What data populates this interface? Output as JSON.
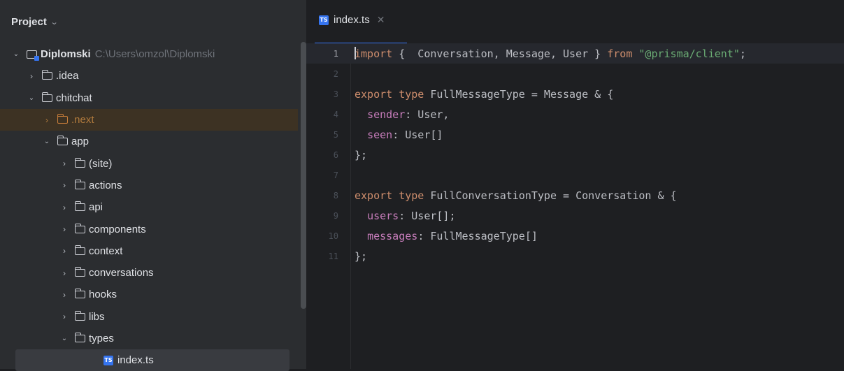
{
  "project_panel": {
    "title": "Project",
    "tree": [
      {
        "label": "Diplomski",
        "path": "C:\\Users\\omzol\\Diplomski"
      },
      {
        "label": ".idea"
      },
      {
        "label": "chitchat"
      },
      {
        "label": ".next"
      },
      {
        "label": "app"
      },
      {
        "label": "(site)"
      },
      {
        "label": "actions"
      },
      {
        "label": "api"
      },
      {
        "label": "components"
      },
      {
        "label": "context"
      },
      {
        "label": "conversations"
      },
      {
        "label": "hooks"
      },
      {
        "label": "libs"
      },
      {
        "label": "types"
      },
      {
        "label": "index.ts"
      }
    ]
  },
  "editor": {
    "tab": {
      "label": "index.ts",
      "icon_text": "TS"
    },
    "current_line": 1,
    "lines": [
      {
        "n": "1",
        "t": [
          {
            "k": "kw",
            "v": "import"
          },
          {
            "k": "p",
            "v": " {  Conversation, Message, User } "
          },
          {
            "k": "kw",
            "v": "from"
          },
          {
            "k": "p",
            "v": " "
          },
          {
            "k": "str",
            "v": "\"@prisma/client\""
          },
          {
            "k": "p",
            "v": ";"
          }
        ]
      },
      {
        "n": "2",
        "t": []
      },
      {
        "n": "3",
        "t": [
          {
            "k": "kw",
            "v": "export type"
          },
          {
            "k": "p",
            "v": " FullMessageType = Message & {"
          }
        ]
      },
      {
        "n": "4",
        "t": [
          {
            "k": "p",
            "v": "  "
          },
          {
            "k": "fld",
            "v": "sender"
          },
          {
            "k": "p",
            "v": ": User,"
          }
        ]
      },
      {
        "n": "5",
        "t": [
          {
            "k": "p",
            "v": "  "
          },
          {
            "k": "fld",
            "v": "seen"
          },
          {
            "k": "p",
            "v": ": User[]"
          }
        ]
      },
      {
        "n": "6",
        "t": [
          {
            "k": "p",
            "v": "};"
          }
        ]
      },
      {
        "n": "7",
        "t": []
      },
      {
        "n": "8",
        "t": [
          {
            "k": "kw",
            "v": "export type"
          },
          {
            "k": "p",
            "v": " FullConversationType = Conversation & {"
          }
        ]
      },
      {
        "n": "9",
        "t": [
          {
            "k": "p",
            "v": "  "
          },
          {
            "k": "fld",
            "v": "users"
          },
          {
            "k": "p",
            "v": ": User[];"
          }
        ]
      },
      {
        "n": "10",
        "t": [
          {
            "k": "p",
            "v": "  "
          },
          {
            "k": "fld",
            "v": "messages"
          },
          {
            "k": "p",
            "v": ": FullMessageType[]"
          }
        ]
      },
      {
        "n": "11",
        "t": [
          {
            "k": "p",
            "v": "};"
          }
        ]
      }
    ]
  },
  "colors": {
    "keyword": "#cf8e6d",
    "string": "#6aab73",
    "field": "#c77dbb",
    "plain": "#bcbec4",
    "accent": "#3574f0",
    "excluded_folder": "#b07a3d"
  },
  "icons": {
    "dropdown": "chevron-down-icon",
    "expanded": "chevron-down-icon",
    "collapsed": "chevron-right-icon",
    "folder": "folder-icon",
    "module": "module-folder-icon",
    "typescript": "typescript-file-icon",
    "close": "close-icon"
  }
}
